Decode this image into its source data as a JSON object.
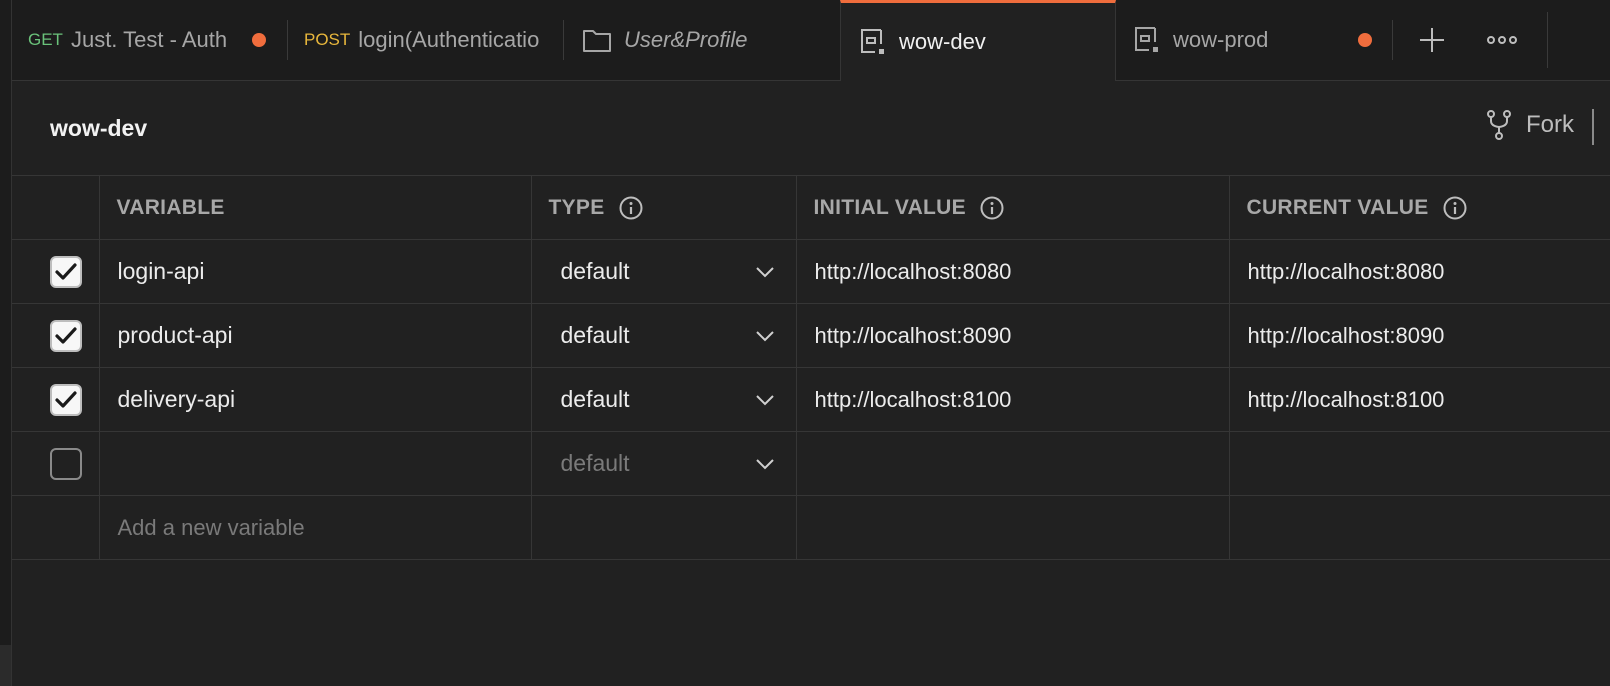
{
  "tabs": [
    {
      "method": "GET",
      "method_color": "#6ac27a",
      "title": "Just. Test - Auth",
      "unsaved": true
    },
    {
      "method": "POST",
      "method_color": "#e8b73c",
      "title": "login(Authenticatio"
    },
    {
      "icon": "folder-icon",
      "title": "User&Profile"
    },
    {
      "icon": "environment-icon",
      "title": "wow-dev",
      "active": true
    },
    {
      "icon": "environment-icon",
      "title": "wow-prod",
      "unsaved": true
    }
  ],
  "environment": {
    "name": "wow-dev",
    "fork_label": "Fork"
  },
  "table": {
    "headers": {
      "variable": "VARIABLE",
      "type": "TYPE",
      "initial_value": "INITIAL VALUE",
      "current_value": "CURRENT VALUE"
    },
    "rows": [
      {
        "enabled": true,
        "variable": "login-api",
        "type": "default",
        "initial_value": "http://localhost:8080",
        "current_value": "http://localhost:8080"
      },
      {
        "enabled": true,
        "variable": "product-api",
        "type": "default",
        "initial_value": "http://localhost:8090",
        "current_value": "http://localhost:8090"
      },
      {
        "enabled": true,
        "variable": "delivery-api",
        "type": "default",
        "initial_value": "http://localhost:8100",
        "current_value": "http://localhost:8100"
      },
      {
        "enabled": false,
        "variable": "",
        "type": "default",
        "initial_value": "",
        "current_value": ""
      }
    ],
    "add_placeholder": "Add a new variable"
  },
  "colors": {
    "accent": "#f06d3d",
    "background": "#212121"
  }
}
